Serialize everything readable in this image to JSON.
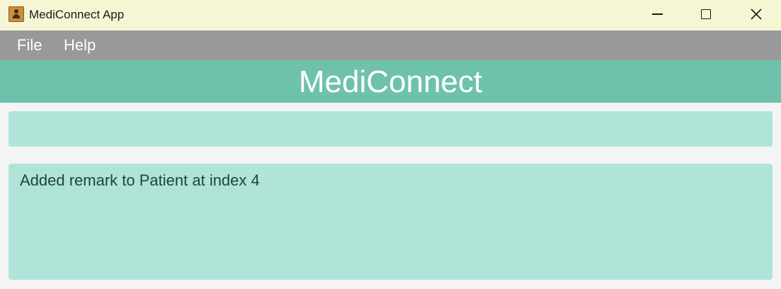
{
  "window": {
    "title": "MediConnect App",
    "icon": "address-book-icon"
  },
  "menubar": {
    "items": [
      {
        "label": "File"
      },
      {
        "label": "Help"
      }
    ]
  },
  "banner": {
    "title": "MediConnect"
  },
  "command": {
    "value": "",
    "placeholder": ""
  },
  "result": {
    "message": "Added remark to Patient at index 4"
  },
  "colors": {
    "titlebar": "#f6f6d4",
    "menubar": "#979a99",
    "banner": "#6ec2ac",
    "panel": "#b0e4d8",
    "background": "#f4f4f4"
  }
}
